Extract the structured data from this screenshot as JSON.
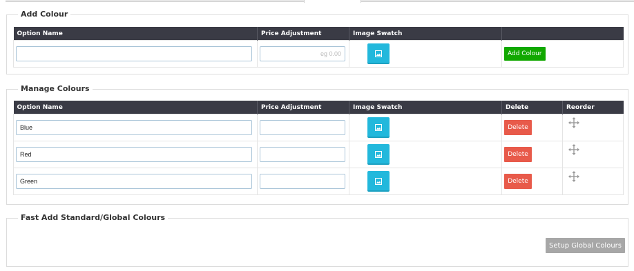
{
  "add_colour": {
    "title": "Add Colour",
    "headers": [
      "Option Name",
      "Price Adjustment",
      "Image Swatch",
      ""
    ],
    "option_name_value": "",
    "price_placeholder": "eg 0.00",
    "add_button_label": "Add Colour",
    "image_swatch_icon": "image-icon"
  },
  "manage_colours": {
    "title": "Manage Colours",
    "headers": [
      "Option Name",
      "Price Adjustment",
      "Image Swatch",
      "Delete",
      "Reorder"
    ],
    "rows": [
      {
        "name": "Blue",
        "price": "",
        "delete_label": "Delete"
      },
      {
        "name": "Red",
        "price": "",
        "delete_label": "Delete"
      },
      {
        "name": "Green",
        "price": "",
        "delete_label": "Delete"
      }
    ],
    "reorder_icon": "move-arrows-icon",
    "image_swatch_icon": "image-icon"
  },
  "fast_add": {
    "title": "Fast Add Standard/Global Colours",
    "setup_button_label": "Setup Global Colours"
  },
  "colors": {
    "header_bg": "#3a3b45",
    "swatch_button": "#22b8dc",
    "add_button": "#11a800",
    "delete_button": "#e85a4a",
    "setup_button": "#a7a7a7"
  }
}
